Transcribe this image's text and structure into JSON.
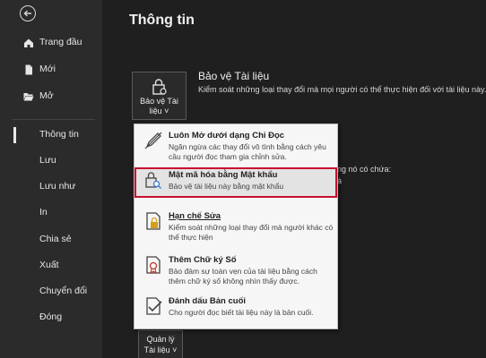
{
  "sidebar": {
    "items": [
      {
        "label": "Trang đầu",
        "icon": "home-icon"
      },
      {
        "label": "Mới",
        "icon": "new-document-icon"
      },
      {
        "label": "Mở",
        "icon": "folder-open-icon"
      },
      {
        "label": "Thông tin"
      },
      {
        "label": "Lưu"
      },
      {
        "label": "Lưu như"
      },
      {
        "label": "In"
      },
      {
        "label": "Chia sẻ"
      },
      {
        "label": "Xuất"
      },
      {
        "label": "Chuyển đổi"
      },
      {
        "label": "Đóng"
      }
    ],
    "selected": "Thông tin"
  },
  "main": {
    "title": "Thông tin",
    "protect": {
      "button_line1": "Bảo vệ Tài",
      "button_line2": "liệu ˅",
      "title": "Bảo vệ Tài liệu",
      "desc": "Kiểm soát những loại thay đổi mà mọi người có thể thực hiện đối với tài liệu này."
    },
    "hidden_fragment1": "ng nó có chứa:",
    "hidden_fragment2": "á",
    "manage": {
      "button_line1": "Quản lý",
      "button_line2": "Tài liệu ˅"
    }
  },
  "menu": {
    "items": [
      {
        "title": "Luôn Mở dưới dạng Chỉ Đọc",
        "desc": "Ngăn ngừa các thay đổi vô tình bằng cách yêu cầu người đọc tham gia chỉnh sửa.",
        "icon": "pencil-read-only-icon"
      },
      {
        "title": "Mật mã hóa bằng Mật khẩu",
        "desc": "Bảo vệ tài liệu này bằng mật khẩu",
        "icon": "lock-key-icon"
      },
      {
        "title": "Hạn chế Sửa",
        "desc": "Kiểm soát những loại thay đổi mà người khác có thể thực hiện",
        "icon": "restrict-edit-icon"
      },
      {
        "title": "Thêm Chữ ký Số",
        "desc": "Bảo đảm sự toàn vẹn của tài liệu bằng cách thêm chữ ký số không nhìn thấy được.",
        "icon": "digital-signature-icon"
      },
      {
        "title": "Đánh dấu Bản cuối",
        "desc": "Cho người đọc biết tài liệu này là bản cuối.",
        "icon": "mark-final-icon"
      }
    ],
    "highlight_color": "#c8102e"
  }
}
